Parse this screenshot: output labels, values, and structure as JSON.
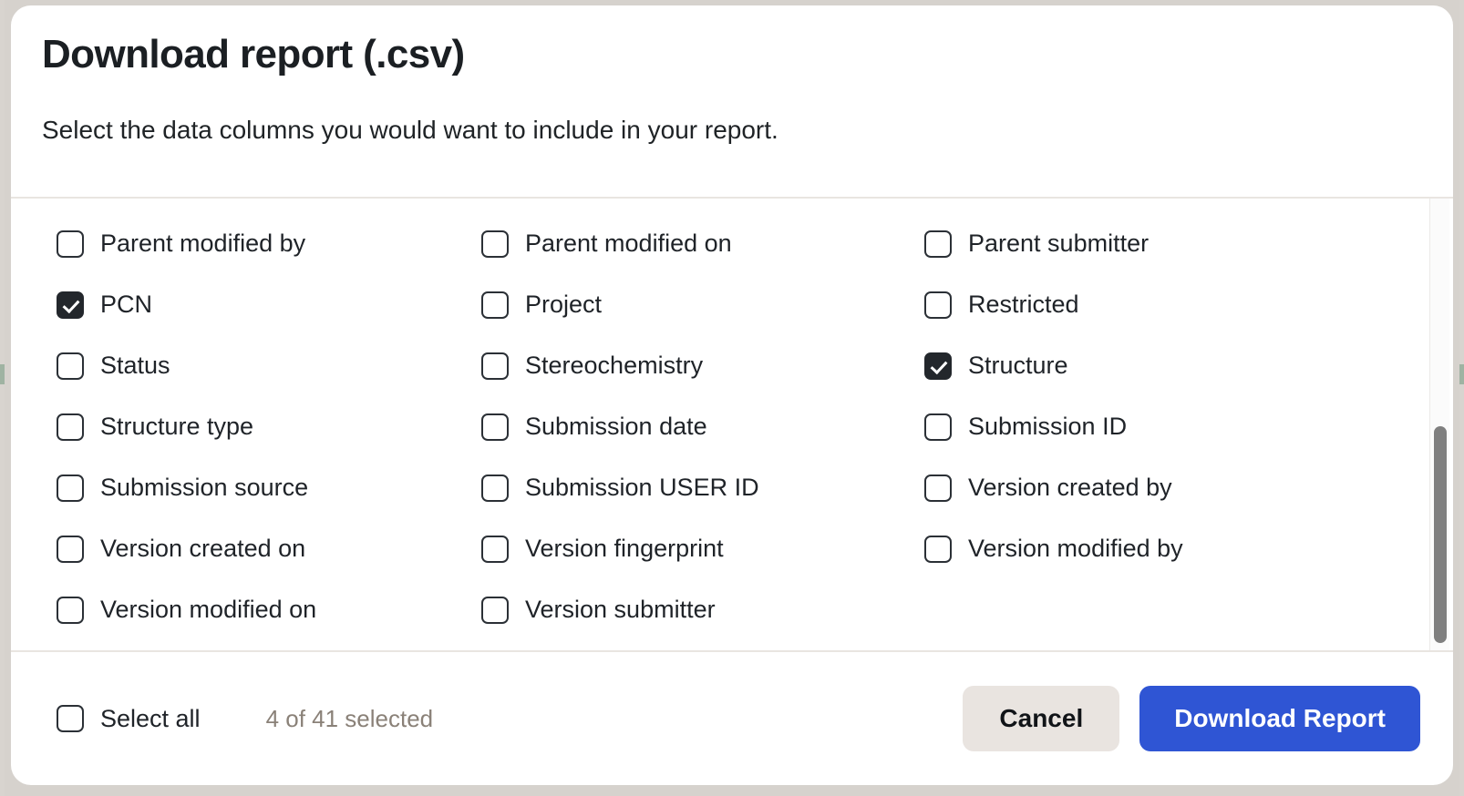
{
  "dialog": {
    "title": "Download report (.csv)",
    "subtitle": "Select the data columns you would want to include in your report."
  },
  "columns": [
    [
      {
        "label": "Parent modified by",
        "checked": false
      },
      {
        "label": "PCN",
        "checked": true
      },
      {
        "label": "Status",
        "checked": false
      },
      {
        "label": "Structure type",
        "checked": false
      },
      {
        "label": "Submission source",
        "checked": false
      },
      {
        "label": "Version created on",
        "checked": false
      },
      {
        "label": "Version modified on",
        "checked": false
      }
    ],
    [
      {
        "label": "Parent modified on",
        "checked": false
      },
      {
        "label": "Project",
        "checked": false
      },
      {
        "label": "Stereochemistry",
        "checked": false
      },
      {
        "label": "Submission date",
        "checked": false
      },
      {
        "label": "Submission USER ID",
        "checked": false
      },
      {
        "label": "Version fingerprint",
        "checked": false
      },
      {
        "label": "Version submitter",
        "checked": false
      }
    ],
    [
      {
        "label": "Parent submitter",
        "checked": false
      },
      {
        "label": "Restricted",
        "checked": false
      },
      {
        "label": "Structure",
        "checked": true
      },
      {
        "label": "Submission ID",
        "checked": false
      },
      {
        "label": "Version created by",
        "checked": false
      },
      {
        "label": "Version modified by",
        "checked": false
      }
    ]
  ],
  "footer": {
    "select_all_label": "Select all",
    "select_all_checked": false,
    "selected_count": "4 of 41 selected",
    "cancel_label": "Cancel",
    "download_label": "Download Report"
  },
  "colors": {
    "primary_button": "#2f55d4",
    "cancel_button": "#e9e4e0",
    "checkbox_checked": "#23272c",
    "muted_text": "#8a8178",
    "divider": "#e9e5e1",
    "backdrop": "#d6d2cd"
  },
  "scrollbar": {
    "thumb_color": "#7f7f7f",
    "track_color": "#fbfbfb"
  }
}
